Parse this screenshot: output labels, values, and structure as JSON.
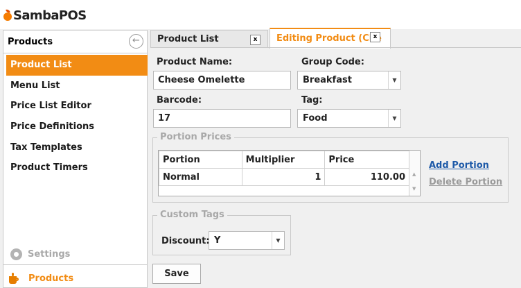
{
  "app": {
    "logo_text": "SambaPOS"
  },
  "sidebar": {
    "title": "Products",
    "items": [
      {
        "label": "Product List"
      },
      {
        "label": "Menu List"
      },
      {
        "label": "Price List Editor"
      },
      {
        "label": "Price Definitions"
      },
      {
        "label": "Tax Templates"
      },
      {
        "label": "Product Timers"
      }
    ],
    "settings_label": "Settings",
    "bottom_label": "Products"
  },
  "tabs": [
    {
      "label": "Product List",
      "close": "x"
    },
    {
      "label": "Editing Product (Che",
      "close": "x"
    }
  ],
  "form": {
    "product_name_label": "Product Name:",
    "product_name_value": "Cheese Omelette",
    "group_code_label": "Group Code:",
    "group_code_value": "Breakfast",
    "barcode_label": "Barcode:",
    "barcode_value": "17",
    "tag_label": "Tag:",
    "tag_value": "Food"
  },
  "portion_prices": {
    "title": "Portion Prices",
    "columns": [
      "Portion",
      "Multiplier",
      "Price"
    ],
    "rows": [
      {
        "portion": "Normal",
        "multiplier": "1",
        "price": "110.00"
      }
    ],
    "add_label": "Add Portion",
    "delete_label": "Delete Portion"
  },
  "custom_tags": {
    "title": "Custom Tags",
    "discount_label": "Discount:",
    "discount_value": "Y"
  },
  "save_label": "Save",
  "colors": {
    "accent": "#f28c14",
    "link": "#1e5aa8"
  }
}
